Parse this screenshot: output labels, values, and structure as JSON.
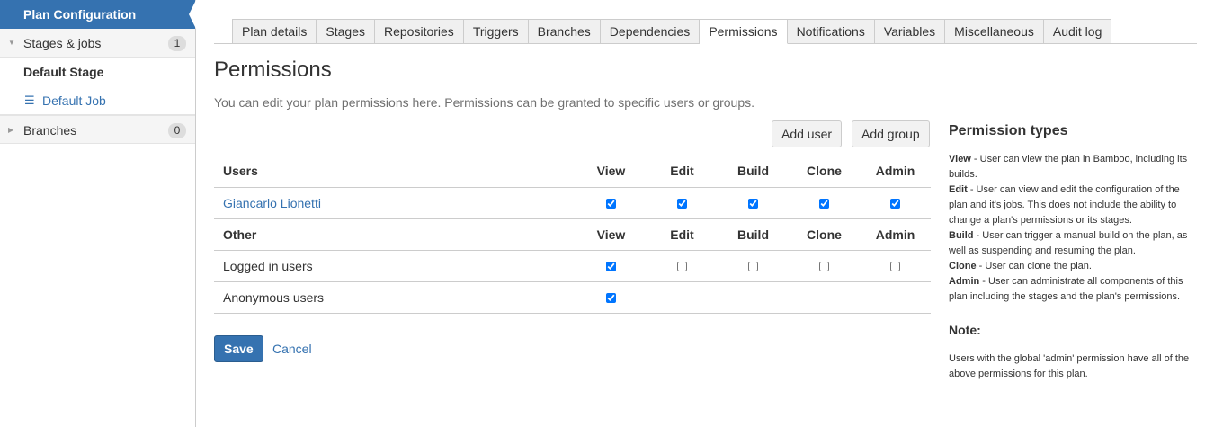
{
  "sidebar": {
    "header": "Plan Configuration",
    "stages_jobs": {
      "label": "Stages & jobs",
      "count": "1"
    },
    "stage": "Default Stage",
    "job": "Default Job",
    "branches": {
      "label": "Branches",
      "count": "0"
    }
  },
  "tabs": [
    "Plan details",
    "Stages",
    "Repositories",
    "Triggers",
    "Branches",
    "Dependencies",
    "Permissions",
    "Notifications",
    "Variables",
    "Miscellaneous",
    "Audit log"
  ],
  "active_tab": "Permissions",
  "page": {
    "title": "Permissions",
    "intro": "You can edit your plan permissions here. Permissions can be granted to specific users or groups."
  },
  "buttons": {
    "add_user": "Add user",
    "add_group": "Add group",
    "save": "Save",
    "cancel": "Cancel"
  },
  "columns": [
    "View",
    "Edit",
    "Build",
    "Clone",
    "Admin"
  ],
  "users_section": {
    "header": "Users",
    "rows": [
      {
        "name": "Giancarlo Lionetti",
        "checks": [
          true,
          true,
          true,
          true,
          true
        ]
      }
    ]
  },
  "other_section": {
    "header": "Other",
    "rows": [
      {
        "name": "Logged in users",
        "checks": [
          true,
          false,
          false,
          false,
          false
        ]
      },
      {
        "name": "Anonymous users",
        "checks": [
          true
        ]
      }
    ]
  },
  "help": {
    "title": "Permission types",
    "items": [
      {
        "term": "View",
        "text": " - User can view the plan in Bamboo, including its builds."
      },
      {
        "term": "Edit",
        "text": " - User can view and edit the configuration of the plan and it's jobs. This does not include the ability to change a plan's permissions or its stages."
      },
      {
        "term": "Build",
        "text": " - User can trigger a manual build on the plan, as well as suspending and resuming the plan."
      },
      {
        "term": "Clone",
        "text": " - User can clone the plan."
      },
      {
        "term": "Admin",
        "text": " - User can administrate all components of this plan including the stages and the plan's permissions."
      }
    ],
    "note_title": "Note:",
    "note": "Users with the global 'admin' permission have all of the above permissions for this plan."
  }
}
